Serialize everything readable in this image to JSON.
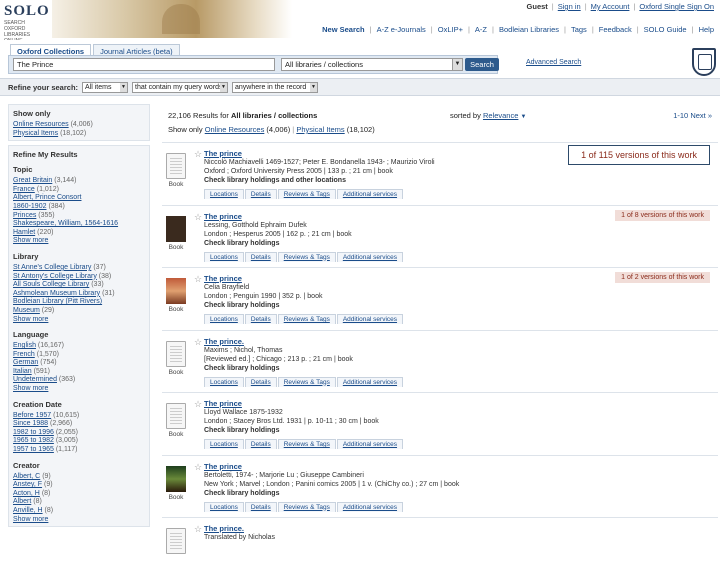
{
  "header": {
    "logo_text": "SOLO",
    "logo_sub": "SEARCH OXFORD LIBRARIES ONLINE",
    "guest_label": "Guest",
    "user_links": [
      "Sign in",
      "My Account",
      "Oxford Single Sign On"
    ],
    "nav": [
      "New Search",
      "A-Z e-Journals",
      "OxLIP+",
      "A-Z",
      "Bodleian Libraries",
      "Tags",
      "Feedback",
      "SOLO Guide",
      "Help"
    ]
  },
  "search": {
    "tabs": [
      "Oxford Collections",
      "Journal Articles (beta)"
    ],
    "query": "The Prince",
    "scope": "All libraries / collections",
    "button": "Search",
    "advanced": "Advanced Search"
  },
  "refine": {
    "label": "Refine your search:",
    "field": "All items",
    "mode": "that contain my query words",
    "where": "anywhere in the record"
  },
  "sidebar": {
    "show_only": {
      "title": "Show only",
      "items": [
        {
          "label": "Online Resources",
          "count": "(4,006)"
        },
        {
          "label": "Physical Items",
          "count": "(18,102)"
        }
      ]
    },
    "refine_title": "Refine My Results",
    "topic": {
      "title": "Topic",
      "items": [
        {
          "label": "Great Britain",
          "count": "(3,144)"
        },
        {
          "label": "France",
          "count": "(1,012)"
        },
        {
          "label": "Albert, Prince Consort",
          "count": ""
        },
        {
          "label": "1860-1902",
          "count": "(384)"
        },
        {
          "label": "Princes",
          "count": "(355)"
        },
        {
          "label": "Shakespeare, William, 1564-1616",
          "count": ""
        },
        {
          "label": "Hamlet",
          "count": "(220)"
        },
        {
          "label": "Show more",
          "count": ""
        }
      ]
    },
    "library": {
      "title": "Library",
      "items": [
        {
          "label": "St Anne's College Library",
          "count": "(37)"
        },
        {
          "label": "St Antony's College Library",
          "count": "(38)"
        },
        {
          "label": "All Souls College Library",
          "count": "(33)"
        },
        {
          "label": "Ashmolean Museum Library",
          "count": "(31)"
        },
        {
          "label": "Bodleian Library (Pitt Rivers)",
          "count": ""
        },
        {
          "label": "Museum",
          "count": "(29)"
        },
        {
          "label": "Show more",
          "count": ""
        }
      ]
    },
    "language": {
      "title": "Language",
      "items": [
        {
          "label": "English",
          "count": "(16,167)"
        },
        {
          "label": "French",
          "count": "(1,570)"
        },
        {
          "label": "German",
          "count": "(754)"
        },
        {
          "label": "Italian",
          "count": "(591)"
        },
        {
          "label": "Undetermined",
          "count": "(363)"
        },
        {
          "label": "Show more",
          "count": ""
        }
      ]
    },
    "creation_date": {
      "title": "Creation Date",
      "items": [
        {
          "label": "Before 1957",
          "count": "(10,615)"
        },
        {
          "label": "Since 1988",
          "count": "(2,966)"
        },
        {
          "label": "1982 to 1996",
          "count": "(2,055)"
        },
        {
          "label": "1965 to 1982",
          "count": "(3,005)"
        },
        {
          "label": "1957 to 1965",
          "count": "(1,117)"
        }
      ]
    },
    "creator": {
      "title": "Creator",
      "items": [
        {
          "label": "Albert, C",
          "count": "(9)"
        },
        {
          "label": "Anstey, F",
          "count": "(9)"
        },
        {
          "label": "Acton, H",
          "count": "(8)"
        },
        {
          "label": "Albert",
          "count": "(8)"
        },
        {
          "label": "Anville, H",
          "count": "(8)"
        },
        {
          "label": "Show more",
          "count": ""
        }
      ]
    }
  },
  "results_header": {
    "count_text": "22,106 Results for",
    "scope_text": "All libraries / collections",
    "sort_label": "sorted by",
    "sort_value": "Relevance",
    "next_link": "1-10 Next »",
    "show_only_label": "Show only",
    "online_link": "Online Resources",
    "online_count": "(4,006)",
    "physical_link": "Physical Items",
    "physical_count": "(18,102)"
  },
  "results": [
    {
      "title": "The prince",
      "line1": "Niccolò Machiavelli 1469-1527; Peter E. Bondanella 1943- ; Maurizio Viroli",
      "line2": "Oxford ; Oxford University Press 2005 | 133 p. ; 21 cm | book",
      "line3": "Check library holdings and other locations",
      "type": "Book",
      "versions": "1 of 115 versions of this work",
      "tabs": [
        "Locations",
        "Details",
        "Reviews & Tags",
        "Additional services"
      ]
    },
    {
      "title": "The prince",
      "line1": "Lessing, Gotthold Ephraim Dufek",
      "line2": "London ; Hesperus 2005 | 162 p. ; 21 cm | book",
      "line3": "Check library holdings",
      "type": "Book",
      "versions": "1 of 8 versions of this work",
      "tabs": [
        "Locations",
        "Details",
        "Reviews & Tags",
        "Additional services"
      ]
    },
    {
      "title": "The prince",
      "line1": "Celia Brayfield",
      "line2": "London ; Penguin 1990 | 352 p. | book",
      "line3": "Check library holdings",
      "type": "Book",
      "versions": "1 of 2 versions of this work",
      "tabs": [
        "Locations",
        "Details",
        "Reviews & Tags",
        "Additional services"
      ]
    },
    {
      "title": "The prince.",
      "line1": "Maxims ; Nichol, Thomas",
      "line2": "[Reviewed ed.] ; Chicago ; 213 p. ; 21 cm | book",
      "line3": "Check library holdings",
      "type": "Book",
      "versions": "",
      "tabs": [
        "Locations",
        "Details",
        "Reviews & Tags",
        "Additional services"
      ]
    },
    {
      "title": "The prince",
      "line1": "Lloyd Wallace 1875-1932",
      "line2": "London ; Stacey Bros Ltd. 1931 | p. 10-11 ; 30 cm | book",
      "line3": "Check library holdings",
      "type": "Book",
      "versions": "",
      "tabs": [
        "Locations",
        "Details",
        "Reviews & Tags",
        "Additional services"
      ]
    },
    {
      "title": "The prince",
      "line1": "Bertoletti, 1974- ; Marjorie Lu ; Giuseppe Cambineri",
      "line2": "New York ; Marvel ; London ; Panini comics 2005 | 1 v. (ChiChy co.) ; 27 cm | book",
      "line3": "Check library holdings",
      "type": "Book",
      "versions": "",
      "tabs": [
        "Locations",
        "Details",
        "Reviews & Tags",
        "Additional services"
      ]
    },
    {
      "title": "The prince.",
      "line1": "Translated by Nicholas",
      "line2": "",
      "line3": "",
      "type": "",
      "versions": "",
      "tabs": []
    }
  ]
}
